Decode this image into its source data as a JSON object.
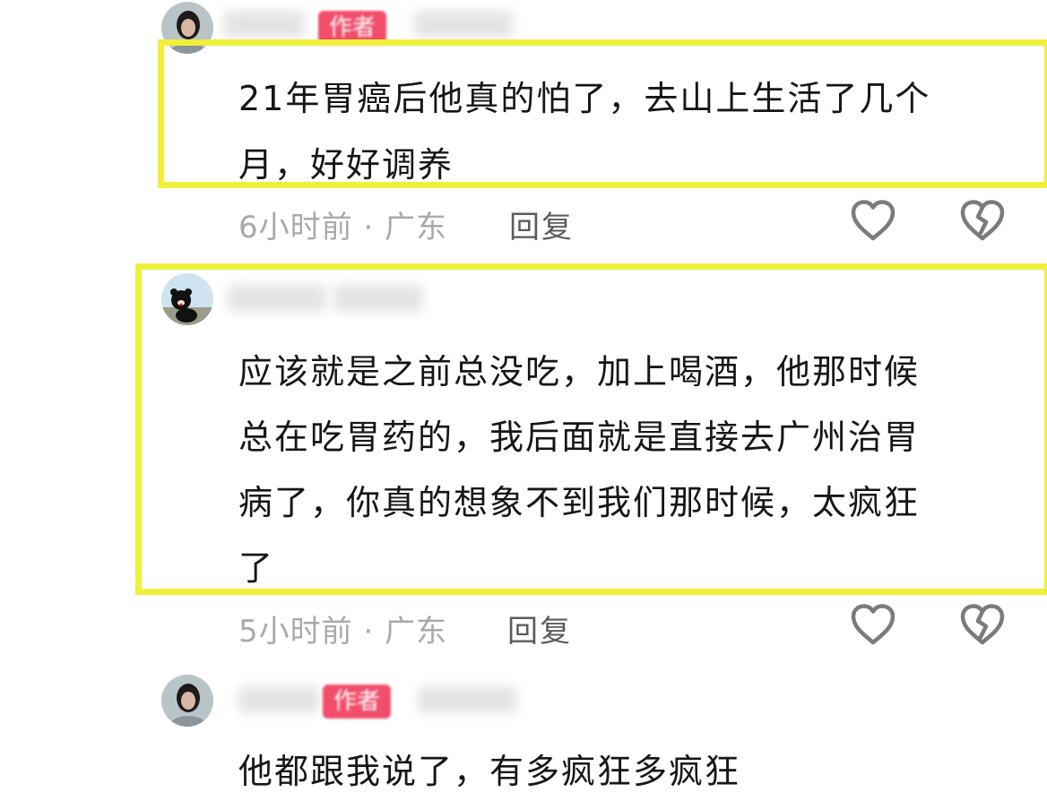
{
  "author_badge": "作者",
  "reply_label": "回复",
  "comments": [
    {
      "lines": [
        "21年胃癌后他真的怕了，去山上生活了几个",
        "月，好好调养"
      ],
      "meta": "6小时前 · 广东"
    },
    {
      "lines": [
        "应该就是之前总没吃，加上喝酒，他那时候",
        "总在吃胃药的，我后面就是直接去广州治胃",
        "病了，你真的想象不到我们那时候，太疯狂",
        "了"
      ],
      "meta": "5小时前 · 广东"
    },
    {
      "lines": [
        "他都跟我说了，有多疯狂多疯狂"
      ]
    }
  ],
  "icons": {
    "like": "heart-outline-icon",
    "dislike": "broken-heart-icon"
  },
  "colors": {
    "highlight": "#f0f03a",
    "badge": "#f24e6b",
    "meta_text": "#a9a9ad",
    "body_text": "#161616"
  }
}
